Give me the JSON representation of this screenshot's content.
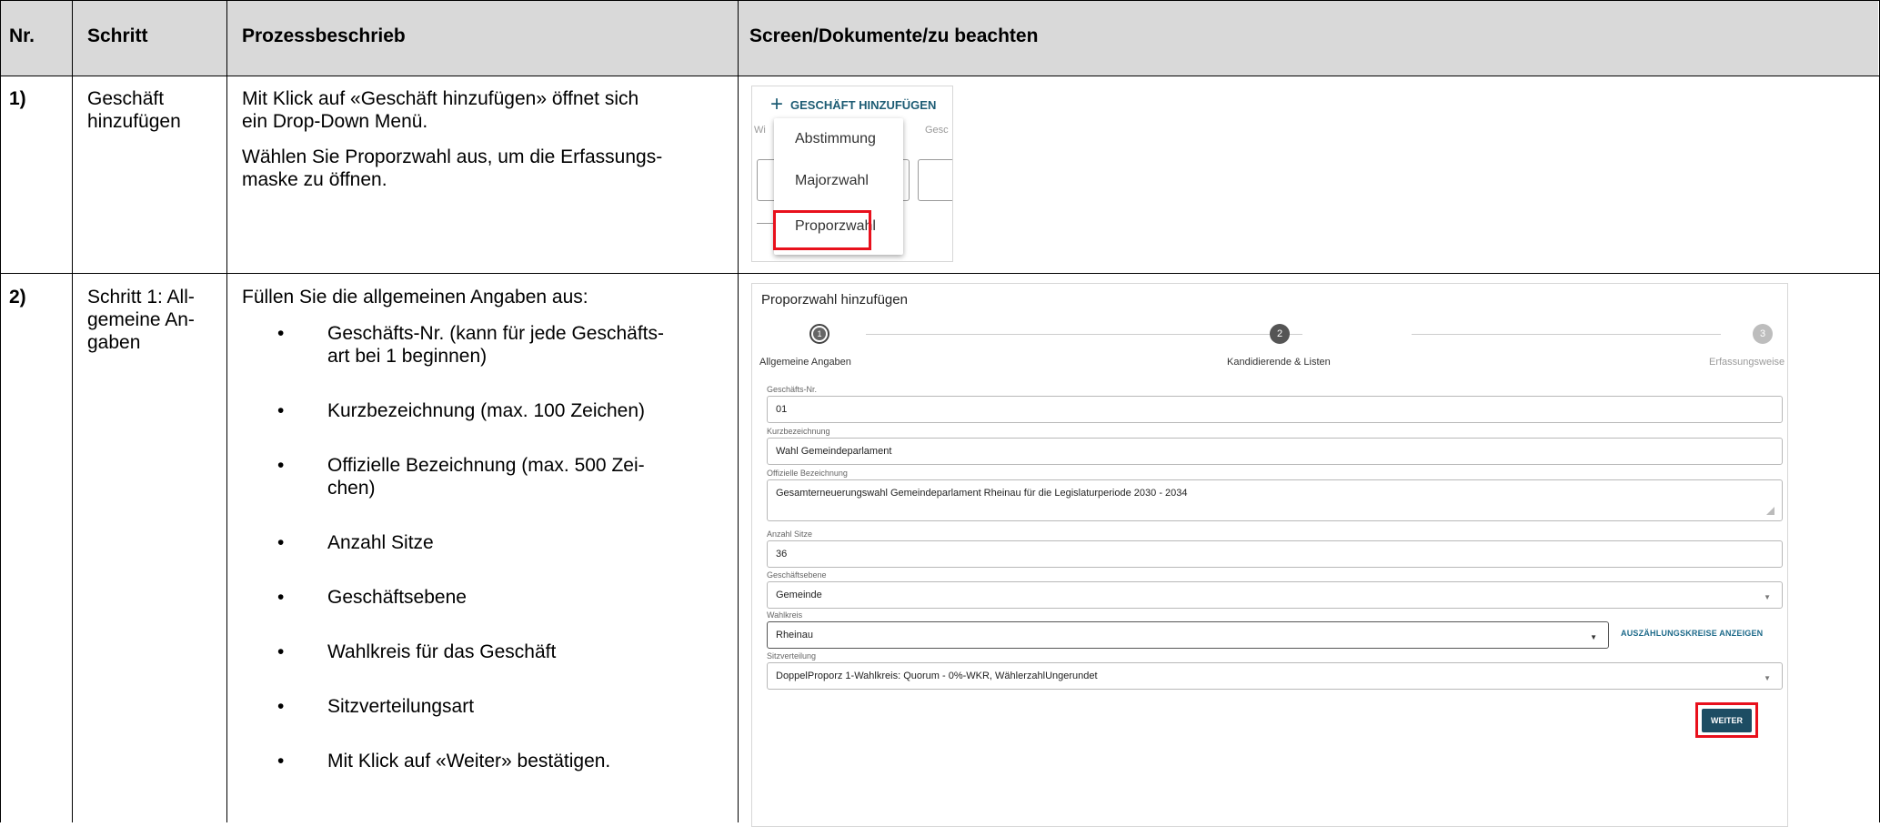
{
  "headers": {
    "nr": "Nr.",
    "schritt": "Schritt",
    "prozess": "Prozessbeschrieb",
    "screen": "Screen/Dokumente/zu beachten"
  },
  "rows": [
    {
      "nr": "1)",
      "schritt_lines": [
        "Geschäft",
        "hinzufügen"
      ],
      "beschrieb_p1": [
        "Mit Klick auf «Geschäft hinzufügen» öffnet sich",
        "ein Drop-Down Menü."
      ],
      "beschrieb_p2": [
        "Wählen Sie Proporzwahl aus, um die Erfassungs-",
        "maske zu öffnen."
      ]
    },
    {
      "nr": "2)",
      "schritt_lines": [
        "Schritt 1: All-",
        "gemeine An-",
        "gaben"
      ],
      "intro": "Füllen Sie die allgemeinen Angaben aus:",
      "bullets": [
        [
          "Geschäfts-Nr. (kann für jede Geschäfts-",
          "art bei 1 beginnen)"
        ],
        [
          "Kurzbezeichnung (max. 100 Zeichen)"
        ],
        [
          "Offizielle Bezeichnung (max. 500 Zei-",
          "chen)"
        ],
        [
          "Anzahl Sitze"
        ],
        [
          "Geschäftsebene"
        ],
        [
          "Wahlkreis für das Geschäft"
        ],
        [
          "Sitzverteilungsart"
        ],
        [
          "Mit Klick auf «Weiter» bestätigen."
        ]
      ]
    }
  ],
  "screenshot1": {
    "add_button": "GESCHÄFT HINZUFÜGEN",
    "bg_fragment_left": "Wi",
    "bg_fragment_right": "Gesc",
    "menu_items": [
      "Abstimmung",
      "Majorzwahl",
      "Proporzwahl"
    ],
    "highlighted_item": "Proporzwahl",
    "highlight_color": "#e8101c"
  },
  "screenshot2": {
    "title": "Proporzwahl hinzufügen",
    "steps": [
      {
        "num": "1",
        "label": "Allgemeine Angaben",
        "state": "active"
      },
      {
        "num": "2",
        "label": "Kandidierende & Listen",
        "state": "upcoming"
      },
      {
        "num": "3",
        "label": "Erfassungsweise",
        "state": "disabled"
      }
    ],
    "fields": {
      "geschaefts_nr": {
        "label": "Geschäfts-Nr.",
        "value": "01"
      },
      "kurzbezeichnung": {
        "label": "Kurzbezeichnung",
        "value": "Wahl Gemeindeparlament"
      },
      "offizielle_bezeichnung": {
        "label": "Offizielle Bezeichnung",
        "value": "Gesamterneuerungswahl Gemeindeparlament Rheinau für die Legislaturperiode 2030 - 2034"
      },
      "anzahl_sitze": {
        "label": "Anzahl Sitze",
        "value": "36"
      },
      "geschaeftsebene": {
        "label": "Geschäftsebene",
        "value": "Gemeinde"
      },
      "wahlkreis": {
        "label": "Wahlkreis",
        "value": "Rheinau"
      },
      "sitzverteilung": {
        "label": "Sitzverteilung",
        "value": "DoppelProporz 1-Wahlkreis: Quorum - 0%-WKR, WählerzahlUngerundet"
      }
    },
    "auszaehlungskreise_link": "AUSZÄHLUNGSKREISE ANZEIGEN",
    "weiter_button": "WEITER",
    "accent_color": "#1d4d63"
  }
}
